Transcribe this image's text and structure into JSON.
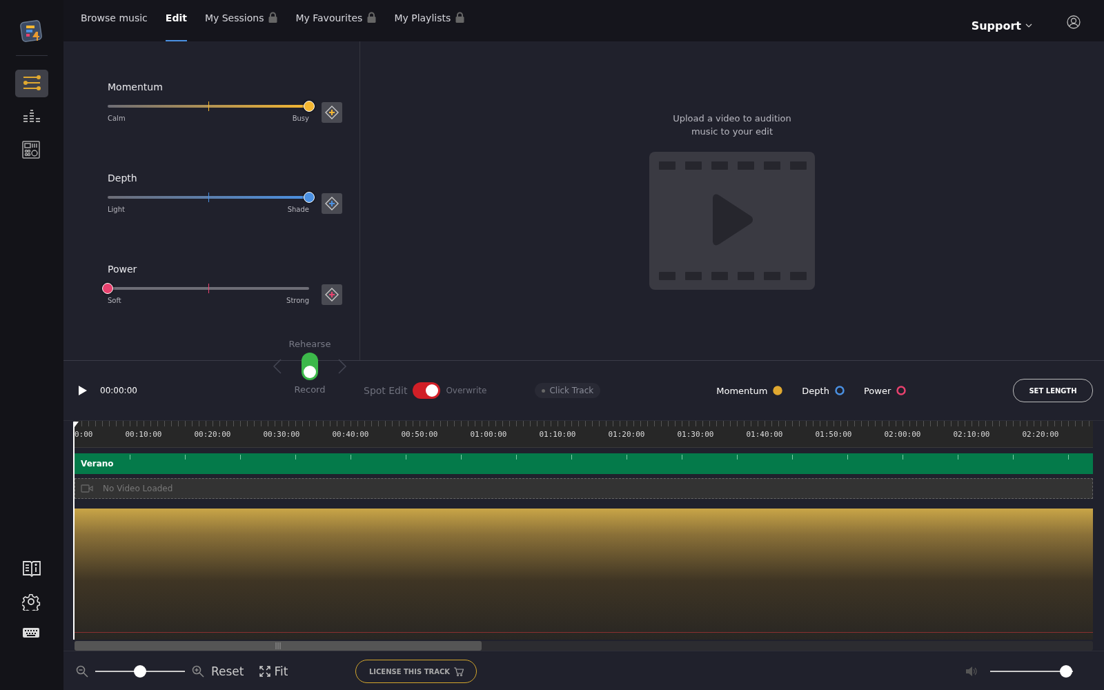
{
  "nav": {
    "tabs": [
      {
        "label": "Browse music",
        "selected": false,
        "locked": false
      },
      {
        "label": "Edit",
        "selected": true,
        "locked": false
      },
      {
        "label": "My Sessions",
        "selected": false,
        "locked": true
      },
      {
        "label": "My Favourites",
        "selected": false,
        "locked": true
      },
      {
        "label": "My Playlists",
        "selected": false,
        "locked": true
      }
    ],
    "support": "Support"
  },
  "sidebar": {
    "items": [
      {
        "kind": "sliders",
        "selected": true
      },
      {
        "kind": "equalizer",
        "selected": false
      },
      {
        "kind": "panel",
        "selected": false
      }
    ],
    "bottom": [
      {
        "kind": "book"
      },
      {
        "kind": "settings"
      },
      {
        "kind": "keyboard"
      }
    ]
  },
  "sliders": [
    {
      "name": "Momentum",
      "low": "Calm",
      "high": "Busy",
      "level": 1,
      "color": "#f5b731"
    },
    {
      "name": "Depth",
      "low": "Light",
      "high": "Shade",
      "level": 1,
      "color": "#4a90e2"
    },
    {
      "name": "Power",
      "low": "Soft",
      "high": "Strong",
      "level": 0,
      "color": "#e8416e"
    }
  ],
  "mode": {
    "top_label": "Rehearse",
    "bottom_label": "Record",
    "record": true
  },
  "video": {
    "message": "Upload a video to audition music to your edit"
  },
  "transport": {
    "time": "00:00:00"
  },
  "spot_edit": {
    "label": "Spot Edit",
    "value_label": "Overwrite",
    "on": true
  },
  "click_track": {
    "label": "Click Track"
  },
  "legend": [
    {
      "label": "Momentum",
      "color": "#e0a830",
      "on": true
    },
    {
      "label": "Depth",
      "color": "#4a90e2",
      "on": false
    },
    {
      "label": "Power",
      "color": "#e8416e",
      "on": false
    }
  ],
  "set_length": "SET LENGTH",
  "timeline": {
    "ticks": [
      "0:00",
      "00:10:00",
      "00:20:00",
      "00:30:00",
      "00:40:00",
      "00:50:00",
      "01:00:00",
      "01:10:00",
      "01:20:00",
      "01:30:00",
      "01:40:00",
      "01:50:00",
      "02:00:00",
      "02:10:00",
      "02:20:00"
    ],
    "track": "Verano",
    "video_track": "No Video Loaded"
  },
  "bottom": {
    "zoom": {
      "level": 0.5
    },
    "reset": "Reset",
    "fit": "Fit",
    "license": "LICENSE THIS TRACK",
    "volume": {
      "level": 0.92
    }
  }
}
